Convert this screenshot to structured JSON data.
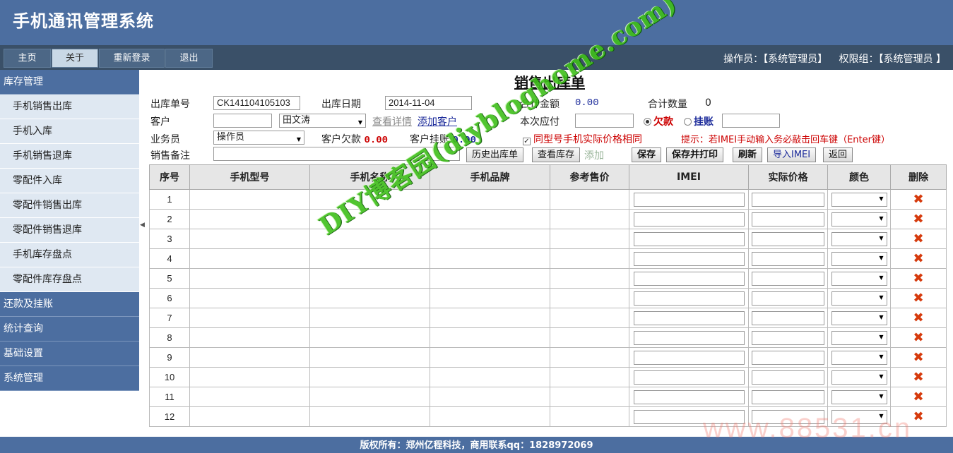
{
  "app": {
    "title": "手机通讯管理系统"
  },
  "menubar": {
    "items": [
      "主页",
      "关于",
      "重新登录",
      "退出"
    ],
    "operator_label": "操作员：",
    "operator_value": "【系统管理员】",
    "group_label": "权限组：",
    "group_value": "【系统管理员 】"
  },
  "sidebar": {
    "inventory_group": "库存管理",
    "inventory_items": [
      "手机销售出库",
      "手机入库",
      "手机销售退库",
      "零配件入库",
      "零配件销售出库",
      "零配件销售退库",
      "手机库存盘点",
      "零配件库存盘点"
    ],
    "groups": [
      "还款及挂账",
      "统计查询",
      "基础设置",
      "系统管理"
    ]
  },
  "form": {
    "title": "销售出库单",
    "order_no_label": "出库单号",
    "order_no_value": "CK141104105103",
    "date_label": "出库日期",
    "date_value": "2014-11-04",
    "total_amount_label": "合计金额",
    "total_amount_value": "0.00",
    "total_qty_label": "合计数量",
    "total_qty_value": "0",
    "customer_label": "客户",
    "customer_input": "",
    "customer_select": "田文涛",
    "view_detail_link": "查看详情",
    "add_customer_link": "添加客户",
    "payable_label": "本次应付",
    "payable_value": "",
    "debt_radio": "欠款",
    "credit_radio": "挂账",
    "radio_extra_value": "",
    "salesperson_label": "业务员",
    "salesperson_select": "操作员",
    "customer_debt_label": "客户欠款",
    "customer_debt_value": "0.00",
    "customer_credit_label": "客户挂账",
    "customer_credit_value": "0.00",
    "same_price_checkbox": "同型号手机实际价格相同",
    "tip": "提示：若IMEI手动输入务必敲击回车键（Enter键）",
    "remark_label": "销售备注",
    "remark_value": "",
    "buttons": {
      "history": "历史出库单",
      "view_stock": "查看库存",
      "add_row": "添加",
      "save": "保存",
      "save_print": "保存并打印",
      "refresh": "刷新",
      "import_imei": "导入IMEI",
      "back": "返回"
    }
  },
  "table": {
    "headers": [
      "序号",
      "手机型号",
      "手机名称",
      "手机品牌",
      "参考售价",
      "IMEI",
      "实际价格",
      "颜色",
      "删除"
    ],
    "row_numbers": [
      "1",
      "2",
      "3",
      "4",
      "5",
      "6",
      "7",
      "8",
      "9",
      "10",
      "11",
      "12"
    ],
    "delete_glyph": "✖"
  },
  "footer": {
    "text": "版权所有：郑州亿程科技，商用联系qq：1828972069"
  },
  "watermarks": {
    "main": "DIY博客园(diybloghome.com)",
    "corner": "www.88531.cn"
  }
}
